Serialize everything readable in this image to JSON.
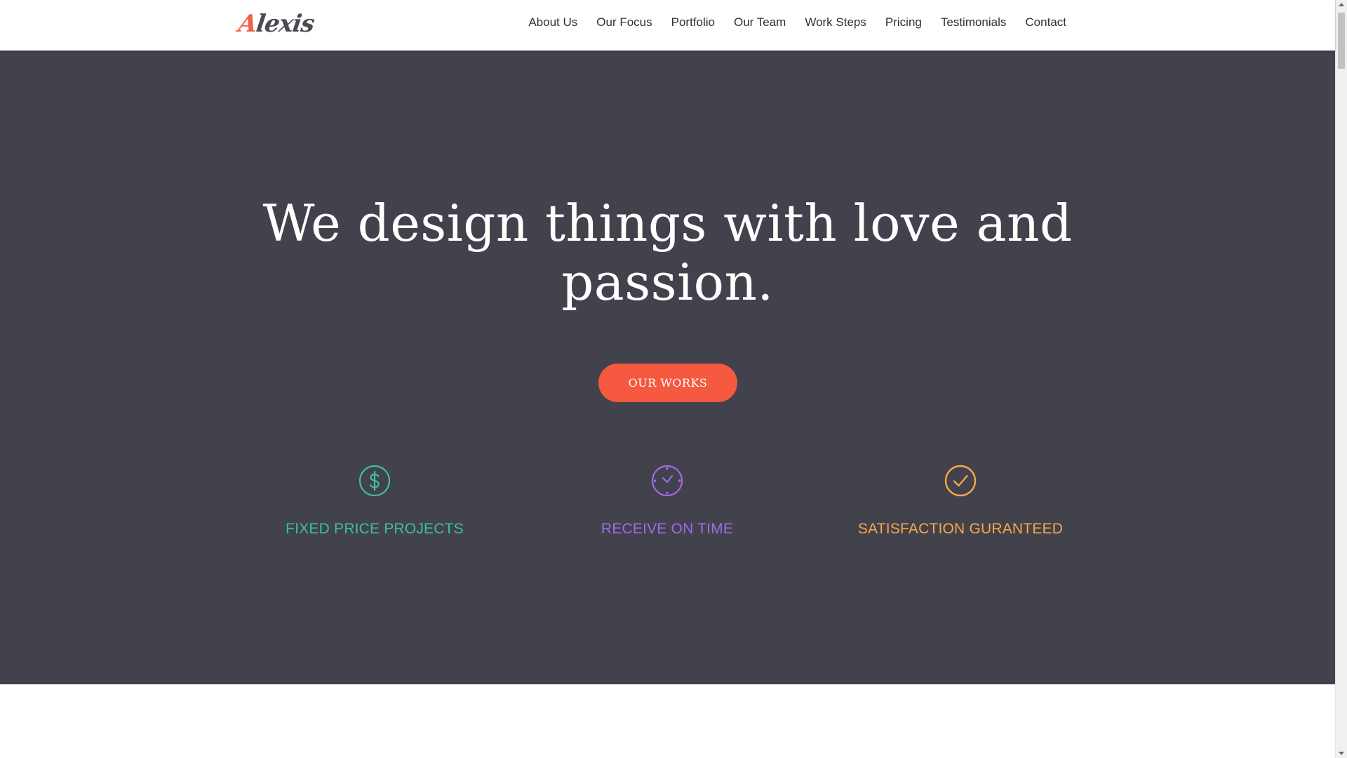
{
  "header": {
    "logo": {
      "initial": "A",
      "rest": "lexis"
    },
    "nav": [
      "About Us",
      "Our Focus",
      "Portfolio",
      "Our Team",
      "Work Steps",
      "Pricing",
      "Testimonials",
      "Contact"
    ]
  },
  "hero": {
    "title_line1": "We design things with love and",
    "title_line2": "passion.",
    "cta_label": "OUR WORKS",
    "features": [
      {
        "label": "FIXED PRICE PROJECTS",
        "icon": "dollar-icon",
        "color": "#3fbf9c"
      },
      {
        "label": "RECEIVE ON TIME",
        "icon": "clock-icon",
        "color": "#a36ae8"
      },
      {
        "label": "SATISFACTION GURANTEED",
        "icon": "check-circle-icon",
        "color": "#f6a84a"
      }
    ]
  },
  "colors": {
    "accent": "#f5593f",
    "hero_background": "#42424c",
    "header_background": "#ffffff"
  }
}
